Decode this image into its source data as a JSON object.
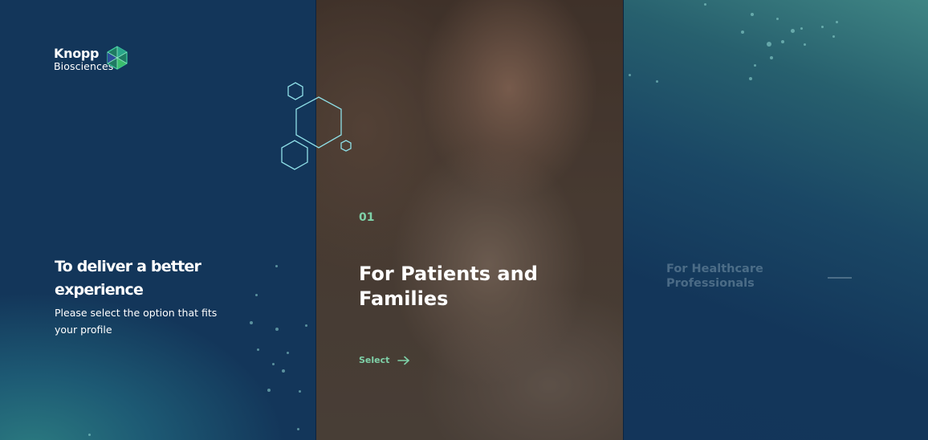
{
  "brand": {
    "name_line1": "Knopp",
    "name_line2": "Biosciences",
    "accent_color": "#7fd1a8",
    "background_color": "#13365a"
  },
  "intro": {
    "title": "To deliver a better experience",
    "subtitle": "Please select the option that fits your profile"
  },
  "options": [
    {
      "number": "01",
      "title": "For Patients and Families",
      "cta_label": "Select",
      "cta_icon": "arrow-right-icon",
      "active": true
    },
    {
      "title": "For Healthcare Professionals",
      "active": false
    }
  ]
}
